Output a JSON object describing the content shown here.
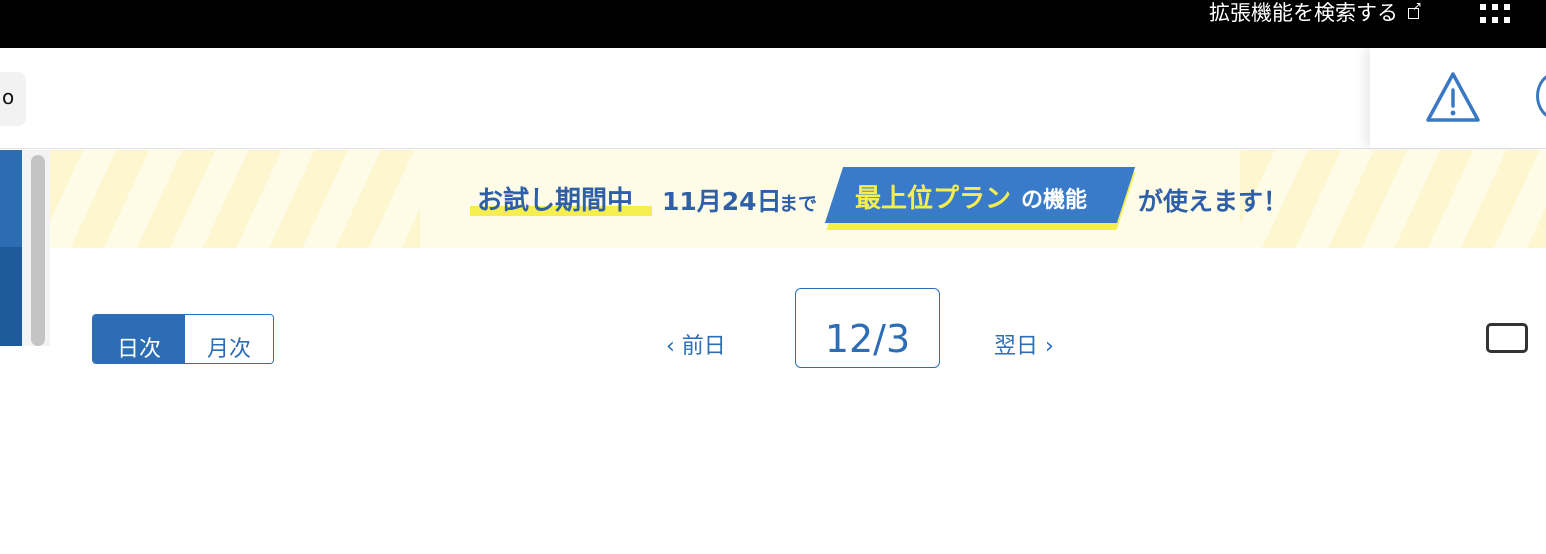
{
  "browser": {
    "extension_search_label": "拡張機能を検索する",
    "external_link_icon": "external-link-icon",
    "apps_icon": "grid-icon"
  },
  "header": {
    "left_chip_text": "o",
    "alert_icon": "warning-triangle-icon",
    "help_icon": "help-circle-icon"
  },
  "sidebar": {
    "toggle_icon": "chevron-right-icon"
  },
  "banner": {
    "trial": "お試し期間中",
    "date": "11月24日",
    "until": "まで",
    "plan": "最上位プラン",
    "of_feature": "の機能",
    "tail": "が使えます！",
    "colors": {
      "text": "#2f5fa6",
      "highlight": "#f6ee4e",
      "plan_bg": "#3a7bc9"
    }
  },
  "controls": {
    "view_daily": "日次",
    "view_monthly": "月次",
    "prev_day": "前日",
    "current_date": "12/3",
    "next_day": "翌日"
  }
}
